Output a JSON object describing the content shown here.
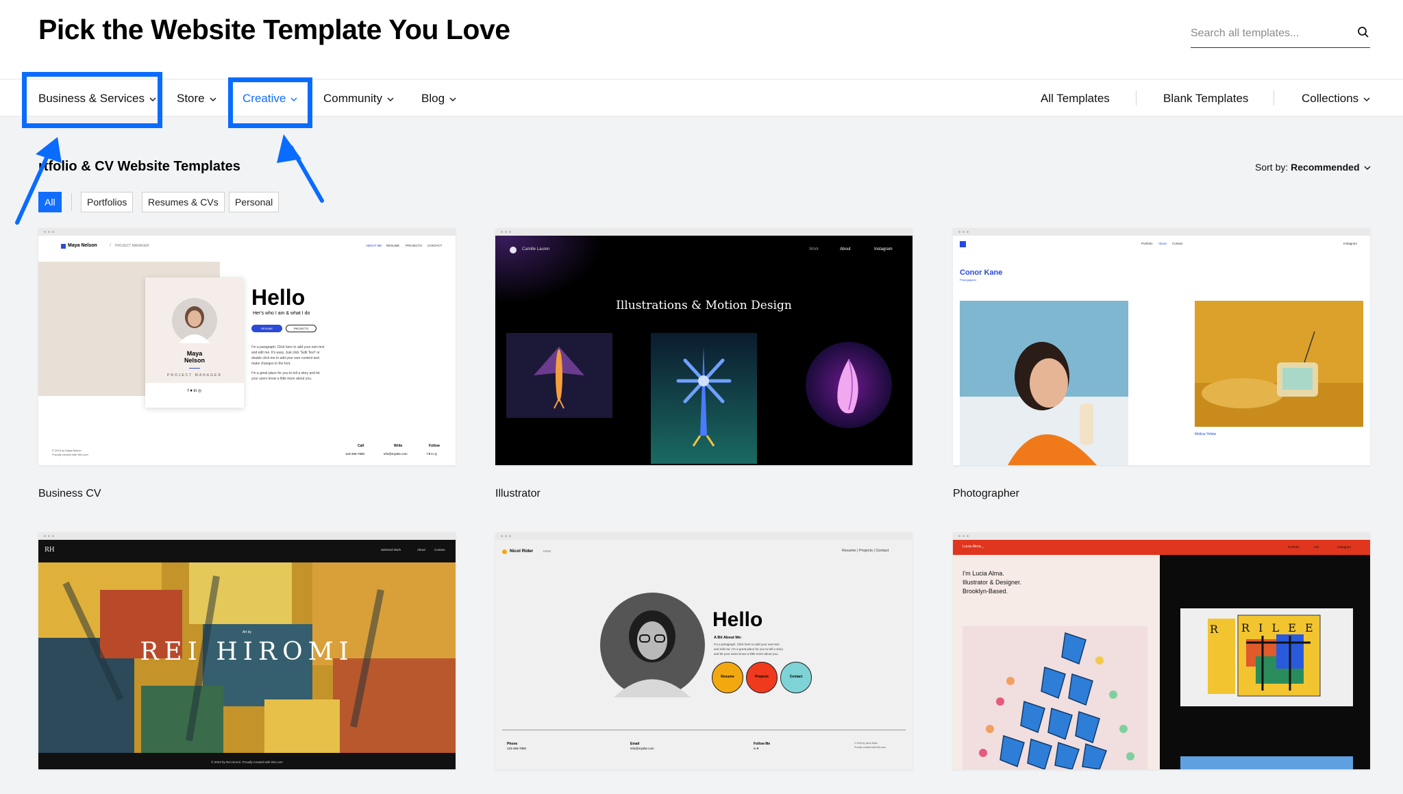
{
  "header": {
    "title": "Pick the Website Template You Love",
    "search_placeholder": "Search all templates..."
  },
  "nav": {
    "left": [
      {
        "label": "Business & Services"
      },
      {
        "label": "Store"
      },
      {
        "label": "Creative"
      },
      {
        "label": "Community"
      },
      {
        "label": "Blog"
      }
    ],
    "right": {
      "all": "All Templates",
      "blank": "Blank Templates",
      "collections": "Collections"
    }
  },
  "section": {
    "title": "rtfolio & CV Website Templates",
    "sort_label": "Sort by:",
    "sort_value": "Recommended",
    "filters": [
      "All",
      "Portfolios",
      "Resumes & CVs",
      "Personal"
    ]
  },
  "templates": [
    {
      "label": "Business CV",
      "preview": {
        "brand": "Maya Nelson",
        "brand_sep": "/",
        "role_header": "PROJECT MANAGER",
        "nav": [
          "ABOUT ME",
          "RESUME",
          "PROJECTS",
          "CONTACT"
        ],
        "heading": "Hello",
        "sub": "Her's who I am & what I do",
        "btn1": "RESUME",
        "btn2": "PROJECTS",
        "name1": "Maya",
        "name2": "Nelson",
        "role": "PROJECT MANAGER",
        "social": "f  ♥  in  ◎",
        "para1": "I'm a paragraph. Click here to add your own text",
        "para2": "and edit me. It's easy. Just click \"Edit Text\" or",
        "para3": "double click me to add your own content and",
        "para4": "make changes to the font.",
        "para5": "I'm a great place for you to tell a story and let",
        "para6": "your users know a little more about you.",
        "foot_left1": "© 2023 by Maya Nelson",
        "foot_left2": "Proudly created with Wix.com",
        "call": "Call",
        "call_val": "123-456-7890",
        "write": "Write",
        "write_val": "info@mysite.com",
        "follow": "Follow",
        "follow_val": "f  ♥  in  ◎"
      }
    },
    {
      "label": "Illustrator",
      "preview": {
        "brand": "Camille Lauren",
        "nav": [
          "Work",
          "About",
          "Instagram"
        ],
        "heading": "Illustrations & Motion Design"
      }
    },
    {
      "label": "Photographer",
      "preview": {
        "nav": [
          "Portfolio",
          "About",
          "Contact"
        ],
        "right": "Instagram",
        "name": "Conor Kane",
        "sub": "Photographer",
        "caption": "Mellow Yellow"
      }
    },
    {
      "label": "",
      "preview": {
        "mono": "RH",
        "nav": [
          "Selected Work",
          "About",
          "Contact"
        ],
        "small": "Art by",
        "heading": "REI HIROMI",
        "foot": "© 2023 by Rei Hiromi. Proudly created with Wix.com"
      }
    },
    {
      "label": "",
      "preview": {
        "brand": "Nicol Rider",
        "brand_sub": "Editor",
        "nav": "Resume  |  Projects  |  Contact",
        "heading": "Hello",
        "sub": "A Bit About Me:",
        "para1": "I'm a paragraph. Click here to add your own text",
        "para2": "and edit me. I'm a great place for you to tell a story",
        "para3": "and let your users know a little more about you.",
        "c1": "Resume",
        "c2": "Projects",
        "c3": "Contact",
        "phone": "Phone",
        "phone_val": "123-456-7890",
        "email": "Email",
        "email_val": "info@mysite.com",
        "follow": "Follow Me",
        "follow_val": "in  ♥",
        "copy1": "© 2023 by Nicol Rider",
        "copy2": "Proudly created with Wix.com"
      }
    },
    {
      "label": "",
      "preview": {
        "brand": "Lucia Alma _",
        "nav": [
          "Portfolio",
          "Info",
          "Instagram"
        ],
        "intro1": "I'm Lucia Alma.",
        "intro2": "Illustrator & Designer.",
        "intro3": "Brooklyn-Based.",
        "book": "R I L E E",
        "book_r": "R"
      }
    }
  ],
  "colors": {
    "accent": "#116dff",
    "highlight": "#0a6cff"
  },
  "icons": {
    "search": "search-icon",
    "chevron": "chevron-down-icon"
  }
}
